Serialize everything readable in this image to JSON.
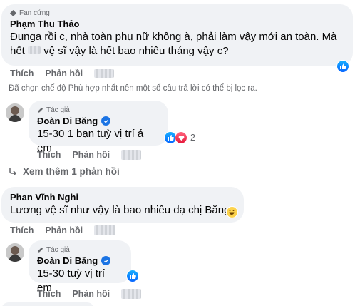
{
  "comments": [
    {
      "badge": "Fan cứng",
      "author": "Phạm Thu Thảo",
      "text_line1": "Đunga rồi c, nhà toàn phụ nữ không à, phải làm vậy mới an toàn. Mà",
      "text_line2_a": "hết",
      "text_line2_b": "vệ sĩ vậy là hết bao nhiêu tháng vậy c?",
      "actions": {
        "like": "Thích",
        "reply": "Phản hồi"
      }
    }
  ],
  "filter_notice": "Đã chọn chế độ Phù hợp nhất nên một số câu trả lời có thể bị lọc ra.",
  "replies": [
    {
      "badge": "Tác giả",
      "author": "Đoàn Di Băng",
      "text": "15-30 1 bạn tuỳ vị trí á em",
      "reaction_count": "2",
      "actions": {
        "like": "Thích",
        "reply": "Phản hồi"
      }
    }
  ],
  "see_more": "Xem thêm 1 phản hồi",
  "comment2": {
    "author": "Phan Vĩnh Nghi",
    "text": "Lương vệ sĩ như vậy là bao nhiêu dạ chị Băng",
    "actions": {
      "like": "Thích",
      "reply": "Phản hồi"
    }
  },
  "reply2": {
    "badge": "Tác giả",
    "author": "Đoàn Di Băng",
    "text": "15-30 tuỳ vị trí em",
    "actions": {
      "like": "Thích",
      "reply": "Phản hồi"
    }
  },
  "colors": {
    "bubble": "#f0f2f5",
    "meta": "#65676b",
    "blue": "#1b74e4"
  }
}
